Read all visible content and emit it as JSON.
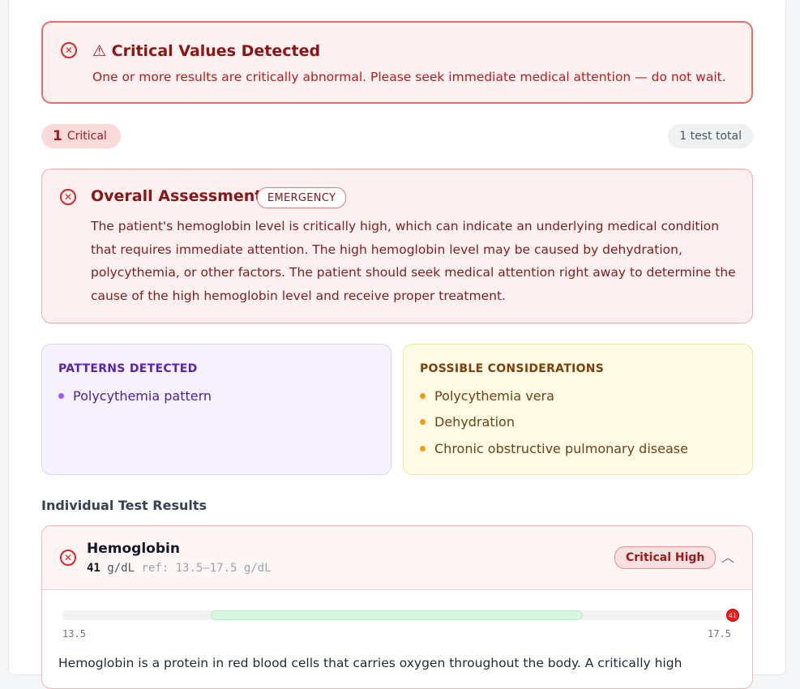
{
  "alert": {
    "title": "⚠ Critical Values Detected",
    "message": "One or more results are critically abnormal. Please seek immediate medical attention — do not wait.",
    "icon": "close-circle-icon",
    "color": "#dc2626"
  },
  "summary": {
    "critical_count": "1",
    "critical_label": "Critical",
    "total_label": "1 test total"
  },
  "assessment": {
    "title": "Overall Assessment",
    "badge": "EMERGENCY",
    "body": "The patient's hemoglobin level is critically high, which can indicate an underlying medical condition that requires immediate attention. The high hemoglobin level may be caused by dehydration, polycythemia, or other factors. The patient should seek medical attention right away to determine the cause of the high hemoglobin level and receive proper treatment."
  },
  "patterns": {
    "heading": "PATTERNS DETECTED",
    "items": [
      "Polycythemia pattern"
    ]
  },
  "considerations": {
    "heading": "POSSIBLE CONSIDERATIONS",
    "items": [
      "Polycythemia vera",
      "Dehydration",
      "Chronic obstructive pulmonary disease"
    ]
  },
  "results": {
    "section_title": "Individual Test Results",
    "tests": [
      {
        "name": "Hemoglobin",
        "value": "41",
        "unit": "g/dL",
        "reference": "ref: 13.5–17.5 g/dL",
        "status": "Critical High",
        "range_min": "13.5",
        "range_max": "17.5",
        "marker_label": "41",
        "description": "Hemoglobin is a protein in red blood cells that carries oxygen throughout the body. A critically high"
      }
    ]
  }
}
